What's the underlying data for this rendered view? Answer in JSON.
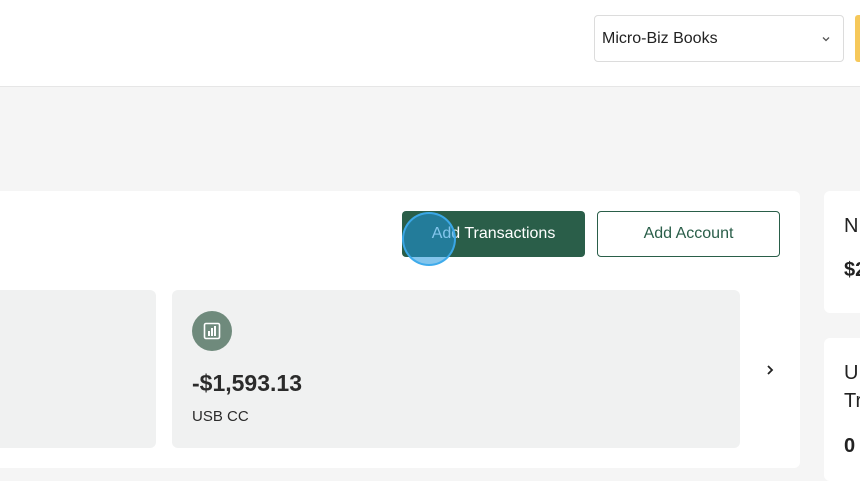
{
  "header": {
    "company_select": {
      "value": "Micro-Biz Books",
      "icon": "chevron-down-icon"
    }
  },
  "toolbar": {
    "add_transactions_label": "Add Transactions",
    "add_account_label": "Add Account"
  },
  "accounts": [
    {
      "icon": "bar-chart-icon",
      "amount": "-$1,593.13",
      "name": "USB CC"
    }
  ],
  "carousel": {
    "next_icon": "chevron-right-icon"
  },
  "side_cards": [
    {
      "title": "N",
      "value": "$2"
    },
    {
      "title_line1": "U",
      "title_line2": "Tr",
      "value": "0"
    }
  ],
  "colors": {
    "primary": "#2a5e49",
    "icon_bg": "#6f8a7c",
    "tile_bg": "#f0f1f1",
    "accent": "#f6c85a"
  }
}
